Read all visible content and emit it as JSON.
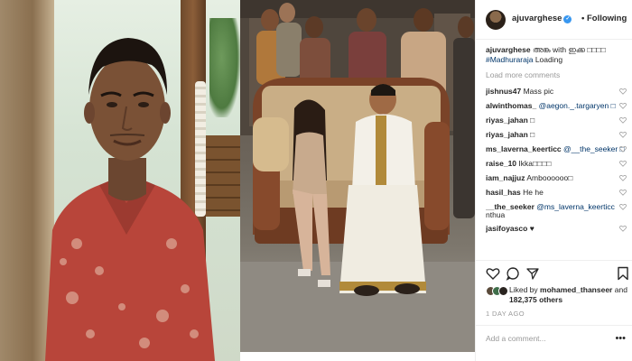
{
  "post": {
    "username": "ajuvarghese",
    "follow_status": "Following",
    "caption_user": "ajuvarghese",
    "caption_text": "അങ്ക with ഇക്ക □□□□",
    "hashtag": "#Madhuraraja",
    "caption_tail": "Loading",
    "load_more": "Load more comments",
    "likes_prefix": "Liked by",
    "likes_user": "mohamed_thanseer",
    "likes_and": "and",
    "likes_count": "182,375 others",
    "time": "1 DAY AGO",
    "add_comment_placeholder": "Add a comment...",
    "more_dots": "•••"
  },
  "comments": [
    {
      "user": "jishnus47",
      "text": "Mass pic",
      "mention": ""
    },
    {
      "user": "alwinthomas_",
      "text": "",
      "mention": "@aegon._.targaryen □"
    },
    {
      "user": "riyas_jahan",
      "text": "□",
      "mention": ""
    },
    {
      "user": "riyas_jahan",
      "text": "□",
      "mention": ""
    },
    {
      "user": "ms_laverna_keerticc",
      "text": "",
      "mention": "@__the_seeker □"
    },
    {
      "user": "raise_10",
      "text": "Ikka□□□□",
      "mention": ""
    },
    {
      "user": "iam_najjuz",
      "text": "Amboooooo□",
      "mention": ""
    },
    {
      "user": "hasil_has",
      "text": "He he",
      "mention": ""
    },
    {
      "user": "__the_seeker",
      "text": "",
      "mention": "@ms_laverna_keerticc"
    },
    {
      "user": "",
      "text": "nthua",
      "mention": ""
    },
    {
      "user": "jasifoyasco",
      "text": "♥",
      "mention": ""
    }
  ],
  "icons": {
    "verified": "verified-badge-icon",
    "like": "heart-icon",
    "comment": "comment-bubble-icon",
    "share": "share-arrow-icon",
    "save": "bookmark-icon"
  },
  "colors": {
    "verified": "#3897f0",
    "hashtag": "#003569",
    "muted": "#999999",
    "text": "#262626"
  }
}
